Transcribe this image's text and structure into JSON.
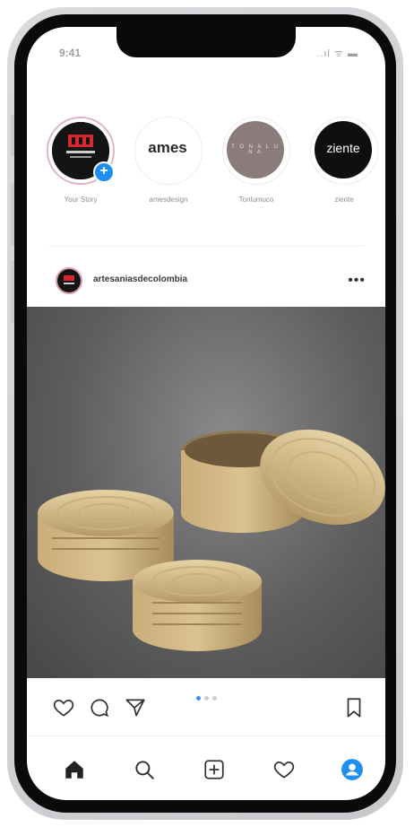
{
  "status_bar": {
    "time": "9:41",
    "signal_wifi_battery": "..ıl ᯤ ▬"
  },
  "stories": [
    {
      "label": "Your Story",
      "has_add_badge": true,
      "icon": "artesanias-logo"
    },
    {
      "label": "amesdesign",
      "logo_text": "ames"
    },
    {
      "label": "Tonlumuco",
      "logo_text": "T O N A  L U N A"
    },
    {
      "label": "ziente",
      "logo_text": "ziente"
    }
  ],
  "post": {
    "username": "artesaniasdecolombia",
    "more_icon": "more-horizontal-icon",
    "image_description_icon": "woven-baskets-image",
    "carousel": {
      "count": 3,
      "active": 0
    }
  },
  "actions": {
    "like": "heart-icon",
    "comment": "comment-icon",
    "share": "send-icon",
    "save": "bookmark-icon"
  },
  "bottom_nav": [
    {
      "name": "home",
      "icon": "home-icon"
    },
    {
      "name": "search",
      "icon": "search-icon"
    },
    {
      "name": "add",
      "icon": "add-post-icon"
    },
    {
      "name": "activity",
      "icon": "heart-icon"
    },
    {
      "name": "profile",
      "icon": "profile-icon"
    }
  ],
  "colors": {
    "accent": "#1d8ff1",
    "story_ring": "#e0b7bd",
    "image_bg": "#5e5e5e"
  }
}
